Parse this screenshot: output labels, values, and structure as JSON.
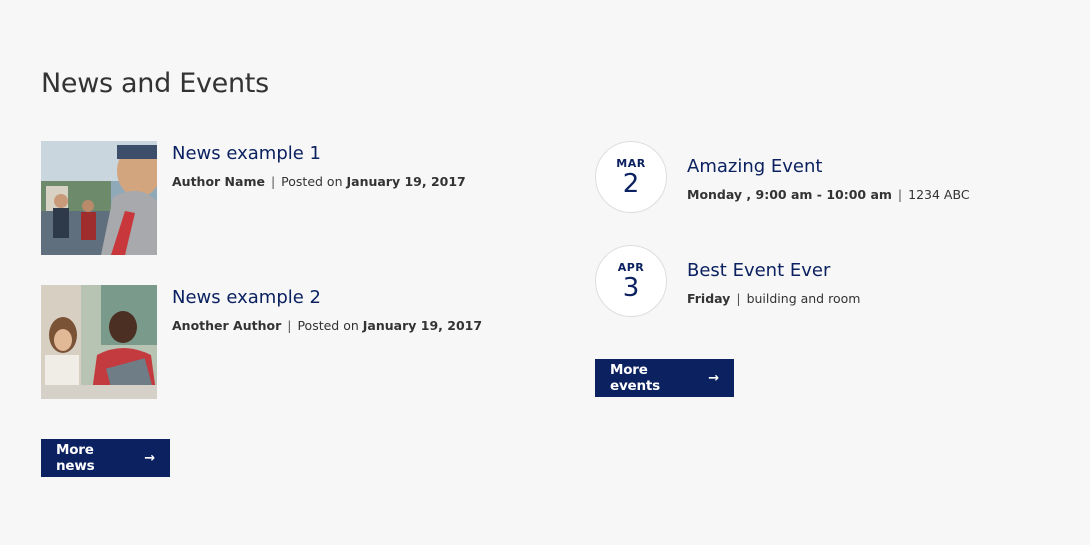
{
  "section": {
    "title": "News and Events"
  },
  "news": [
    {
      "title": "News example 1",
      "author": "Author Name",
      "posted_prefix": "Posted on",
      "date": "January 19, 2017"
    },
    {
      "title": "News example 2",
      "author": "Another Author",
      "posted_prefix": "Posted on",
      "date": "January 19, 2017"
    }
  ],
  "more_news_label": "More news",
  "events": [
    {
      "month": "MAR",
      "day": "2",
      "title": "Amazing Event",
      "when": "Monday , 9:00 am - 10:00 am",
      "where": "1234 ABC"
    },
    {
      "month": "APR",
      "day": "3",
      "title": "Best Event Ever",
      "when": "Friday",
      "where": "building and room"
    }
  ],
  "more_events_label": "More events",
  "separator": "|",
  "arrow_icon": "→",
  "colors": {
    "background": "#f7f7f7",
    "brand_navy": "#0b2160",
    "text": "#333333"
  }
}
